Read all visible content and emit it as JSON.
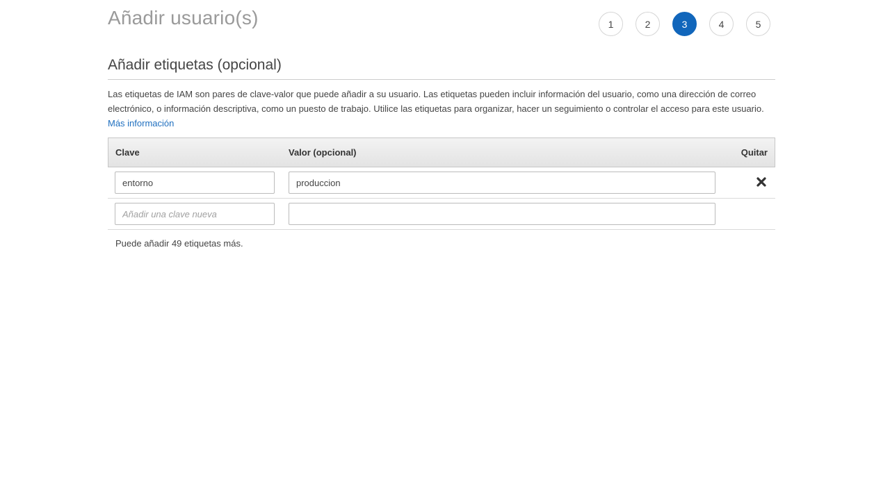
{
  "header": {
    "title": "Añadir usuario(s)"
  },
  "steps": [
    {
      "label": "1",
      "active": false
    },
    {
      "label": "2",
      "active": false
    },
    {
      "label": "3",
      "active": true
    },
    {
      "label": "4",
      "active": false
    },
    {
      "label": "5",
      "active": false
    }
  ],
  "section": {
    "title": "Añadir etiquetas (opcional)",
    "description": "Las etiquetas de IAM son pares de clave-valor que puede añadir a su usuario. Las etiquetas pueden incluir información del usuario, como una dirección de correo electrónico, o información descriptiva, como un puesto de trabajo. Utilice las etiquetas para organizar, hacer un seguimiento o controlar el acceso para este usuario.",
    "learn_more": "Más información"
  },
  "table": {
    "columns": {
      "key": "Clave",
      "value": "Valor (opcional)",
      "remove": "Quitar"
    },
    "rows": [
      {
        "key": "entorno",
        "value": "produccion"
      }
    ],
    "new_row": {
      "key_placeholder": "Añadir una clave nueva",
      "value": ""
    }
  },
  "remaining_text": "Puede añadir 49 etiquetas más.",
  "colors": {
    "accent": "#1166bb",
    "link": "#1f6fbf"
  },
  "icons": {
    "remove": "close-icon"
  }
}
